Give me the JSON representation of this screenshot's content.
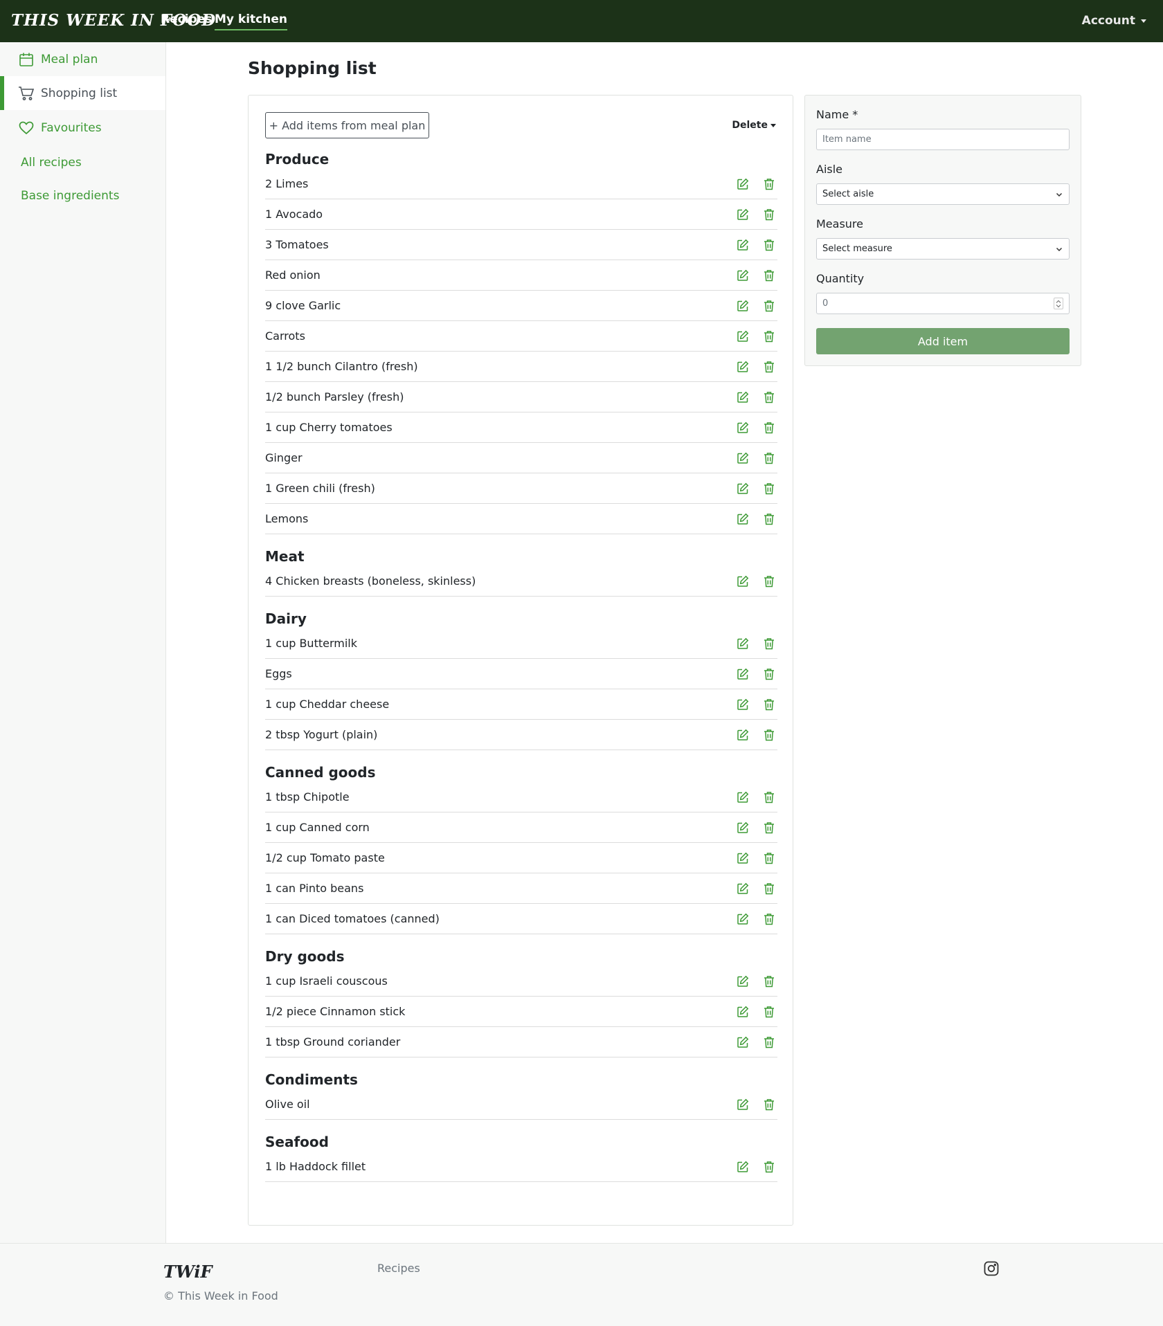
{
  "navbar": {
    "brand": "This Week in Food",
    "links": [
      "Recipes",
      "My kitchen"
    ],
    "account": "Account"
  },
  "sidebar": {
    "items": [
      {
        "label": "Meal plan",
        "icon": "calendar-icon"
      },
      {
        "label": "Shopping list",
        "icon": "cart-icon",
        "active": true
      },
      {
        "label": "Favourites",
        "icon": "heart-icon"
      },
      {
        "label": "All recipes"
      },
      {
        "label": "Base ingredients"
      }
    ]
  },
  "page": {
    "title": "Shopping list",
    "add_from_meal_plan": "+ Add items from meal plan",
    "delete_label": "Delete"
  },
  "aisles": [
    {
      "name": "Produce",
      "items": [
        "2 Limes",
        "1 Avocado",
        "3 Tomatoes",
        "Red onion",
        "9 clove Garlic",
        "Carrots",
        "1 1/2 bunch Cilantro (fresh)",
        "1/2 bunch Parsley (fresh)",
        "1 cup Cherry tomatoes",
        "Ginger",
        "1 Green chili (fresh)",
        "Lemons"
      ]
    },
    {
      "name": "Meat",
      "items": [
        "4 Chicken breasts (boneless, skinless)"
      ]
    },
    {
      "name": "Dairy",
      "items": [
        "1 cup Buttermilk",
        "Eggs",
        "1 cup Cheddar cheese",
        "2 tbsp Yogurt (plain)"
      ]
    },
    {
      "name": "Canned goods",
      "items": [
        "1 tbsp Chipotle",
        "1 cup Canned corn",
        "1/2 cup Tomato paste",
        "1 can Pinto beans",
        "1 can Diced tomatoes (canned)"
      ]
    },
    {
      "name": "Dry goods",
      "items": [
        "1 cup Israeli couscous",
        "1/2 piece Cinnamon stick",
        "1 tbsp Ground coriander"
      ]
    },
    {
      "name": "Condiments",
      "items": [
        "Olive oil"
      ]
    },
    {
      "name": "Seafood",
      "items": [
        "1 lb Haddock fillet"
      ]
    }
  ],
  "form": {
    "name_label": "Name *",
    "name_placeholder": "Item name",
    "aisle_label": "Aisle",
    "aisle_value": "Select aisle",
    "measure_label": "Measure",
    "measure_value": "Select measure",
    "quantity_label": "Quantity",
    "quantity_value": "0",
    "submit_label": "Add item"
  },
  "footer": {
    "logo": "TWiF",
    "copyright": "© This Week in Food",
    "link_recipes": "Recipes",
    "social_icon": "instagram-icon"
  },
  "colors": {
    "navbar_bg": "#1c3218",
    "accent_green": "#3d9a35",
    "button_green": "#73a370"
  }
}
